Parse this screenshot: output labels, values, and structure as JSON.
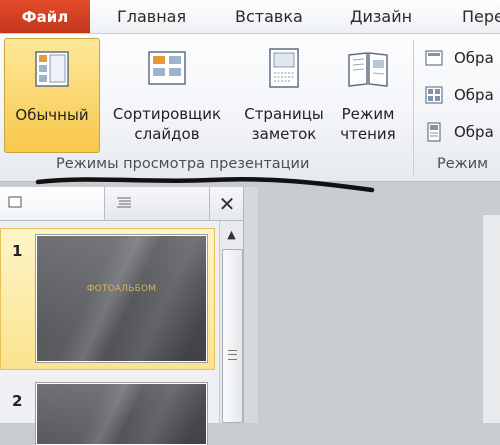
{
  "tabs": {
    "file": "Файл",
    "home": "Главная",
    "insert": "Вставка",
    "design": "Дизайн",
    "partial": "Пере"
  },
  "ribbon": {
    "views": [
      {
        "label_line1": "Обычный",
        "label_line2": "",
        "selected": true,
        "icon": "normal-view-icon"
      },
      {
        "label_line1": "Сортировщик",
        "label_line2": "слайдов",
        "selected": false,
        "icon": "slide-sorter-icon"
      },
      {
        "label_line1": "Страницы",
        "label_line2": "заметок",
        "selected": false,
        "icon": "notes-page-icon"
      },
      {
        "label_line1": "Режим",
        "label_line2": "чтения",
        "selected": false,
        "icon": "reading-view-icon"
      }
    ],
    "group_label": "Режимы просмотра презентации",
    "master_items": [
      "Обра",
      "Обра",
      "Обра"
    ],
    "master_group_label": "Режим"
  },
  "slides": [
    {
      "number": "1",
      "title": "ФОТОАЛЬБОМ"
    },
    {
      "number": "2",
      "title": ""
    }
  ],
  "colors": {
    "file_tab": "#c2361b",
    "selected_button": "#f7c84b",
    "thumb_title": "#d8b455"
  }
}
